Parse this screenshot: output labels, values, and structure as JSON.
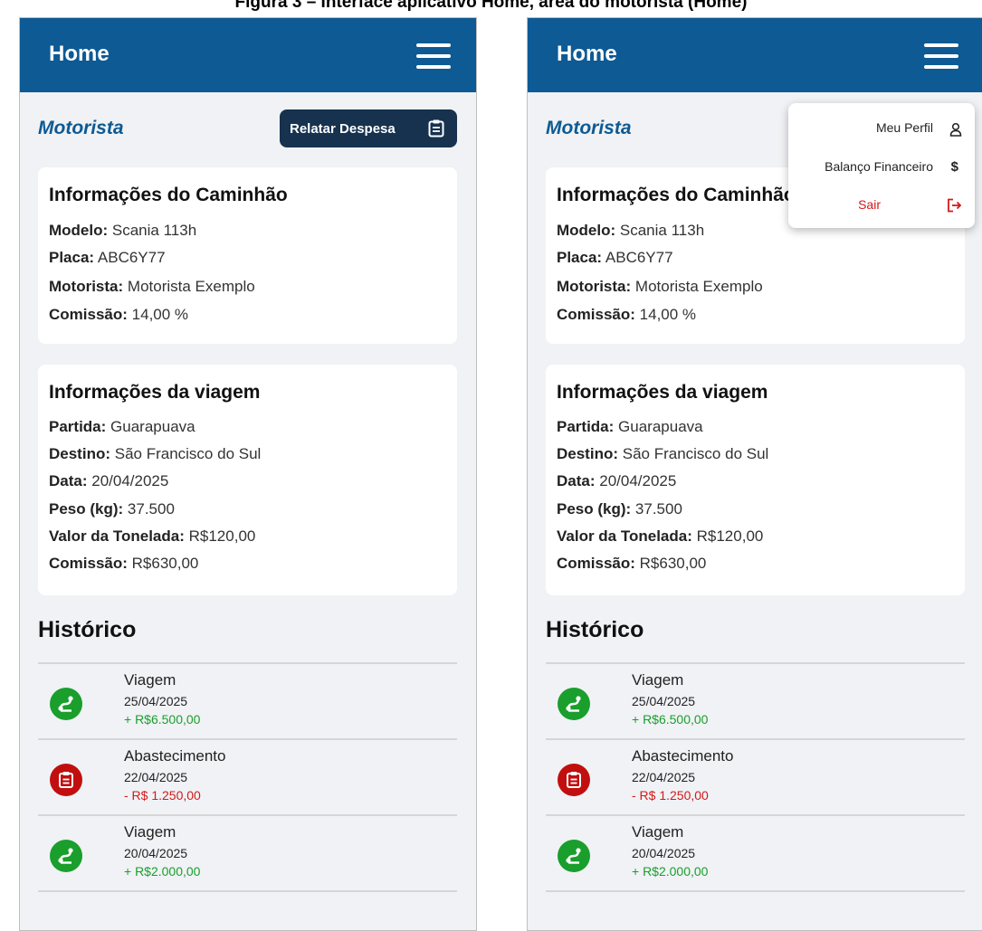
{
  "caption": "Figura 3 – Interface aplicativo Home, área do motorista (Home)",
  "colors": {
    "appbar": "#0d5a94",
    "button": "#16324f",
    "income": "#1a9e2c",
    "expense": "#d11a1a",
    "income_icon_bg": "#1a9e2c",
    "expense_icon_bg": "#c10f0f"
  },
  "appbar": {
    "title": "Home",
    "menu_icon": "hamburger-icon"
  },
  "role_title": "Motorista",
  "report_button": {
    "label": "Relatar Despesa",
    "icon": "clipboard-icon"
  },
  "truck_card": {
    "title": "Informações do Caminhão",
    "rows": [
      {
        "label": "Modelo:",
        "value": "Scania 113h"
      },
      {
        "label": "Placa:",
        "value": "ABC6Y77"
      },
      {
        "label": "Motorista:",
        "value": "Motorista Exemplo"
      },
      {
        "label": "Comissão:",
        "value": " 14,00 %"
      }
    ]
  },
  "trip_card": {
    "title": "Informações da viagem",
    "rows": [
      {
        "label": "Partida:",
        "value": "Guarapuava"
      },
      {
        "label": "Destino:",
        "value": "São Francisco do Sul"
      },
      {
        "label": "Data:",
        "value": "20/04/2025"
      },
      {
        "label": "Peso (kg):",
        "value": "37.500"
      },
      {
        "label": "Valor da Tonelada:",
        "value": "R$120,00"
      },
      {
        "label": "Comissão:",
        "value": "R$630,00"
      }
    ]
  },
  "history": {
    "title": "Histórico",
    "items": [
      {
        "name": "Viagem",
        "date": "25/04/2025",
        "amount": "+ R$6.500,00",
        "kind": "income",
        "icon": "route-icon"
      },
      {
        "name": "Abastecimento",
        "date": "22/04/2025",
        "amount": "- R$ 1.250,00",
        "kind": "expense",
        "icon": "clipboard-icon"
      },
      {
        "name": "Viagem",
        "date": "20/04/2025",
        "amount": "+ R$2.000,00",
        "kind": "income",
        "icon": "route-icon"
      }
    ]
  },
  "dropdown": {
    "items": [
      {
        "label": "Meu Perfil",
        "icon": "user-icon",
        "glyph": "♙"
      },
      {
        "label": "Balanço Financeiro",
        "icon": "dollar-icon",
        "glyph": "$"
      },
      {
        "label": "Sair",
        "icon": "logout-icon",
        "glyph": "↦"
      }
    ]
  }
}
